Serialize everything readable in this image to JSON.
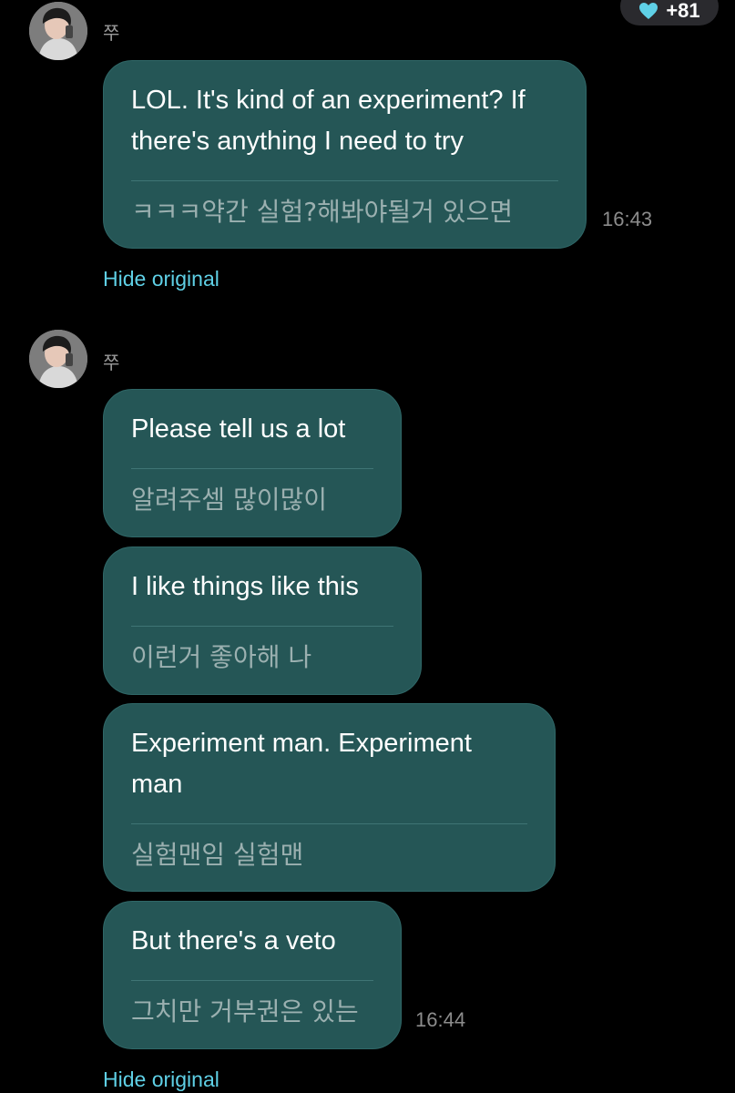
{
  "reaction": {
    "icon": "heart-icon",
    "color": "#5fd0e6",
    "count": "+81"
  },
  "groups": [
    {
      "sender": "쭈",
      "messages": [
        {
          "translated": "LOL. It's kind of an experiment? If there's anything I need to try",
          "original": "ㅋㅋㅋ약간 실험?해봐야될거 있으면",
          "time": "16:43"
        }
      ],
      "hide_label": "Hide original"
    },
    {
      "sender": "쭈",
      "messages": [
        {
          "translated": "Please tell us a lot",
          "original": "알려주셈 많이많이"
        },
        {
          "translated": "I like things like this",
          "original": "이런거 좋아해 나"
        },
        {
          "translated": "Experiment man. Experiment man",
          "original": "실험맨임 실험맨"
        },
        {
          "translated": "But there's a veto",
          "original": "그치만 거부권은 있는",
          "time": "16:44"
        }
      ],
      "hide_label": "Hide original"
    }
  ],
  "colors": {
    "background": "#000000",
    "bubble": "#255656",
    "link": "#5fd0e6"
  }
}
